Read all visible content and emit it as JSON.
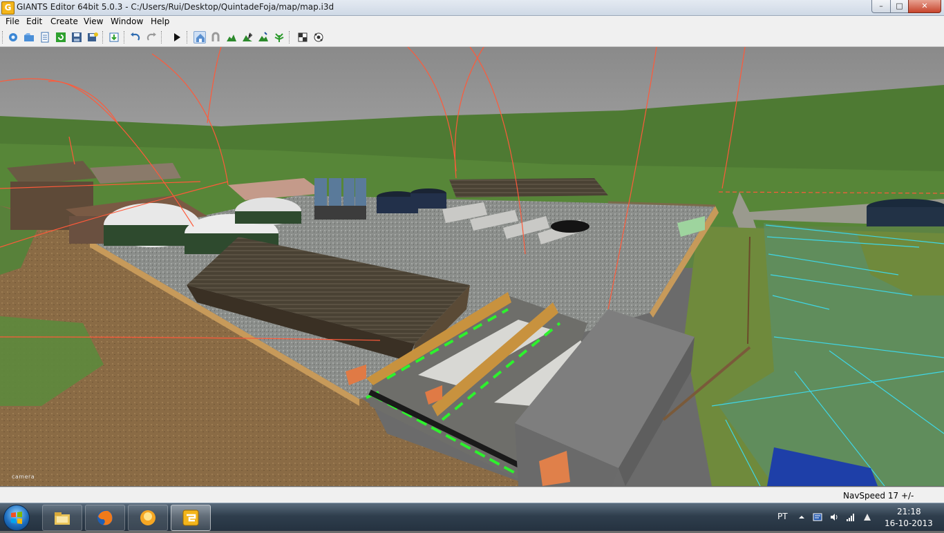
{
  "window": {
    "title": "GIANTS Editor 64bit 5.0.3 - C:/Users/Rui/Desktop/QuintadeFoja/map/map.i3d",
    "app_icon_letter": "G",
    "controls": {
      "minimize": "–",
      "maximize": "□",
      "close": "✕"
    }
  },
  "menu": {
    "items": [
      {
        "label": "File"
      },
      {
        "label": "Edit"
      },
      {
        "label": "Create"
      },
      {
        "label": "View"
      },
      {
        "label": "Window"
      },
      {
        "label": "Help"
      }
    ]
  },
  "toolbar": {
    "buttons": [
      "new-scene-icon",
      "open-icon",
      "properties-icon",
      "refresh-icon",
      "save-icon",
      "save-all-icon",
      "import-icon",
      "undo-icon",
      "redo-icon",
      "play-icon",
      "select-mode-icon",
      "move-mode-icon",
      "terrain-sculpt-icon",
      "terrain-paint-icon",
      "foliage-paint-icon",
      "plant-paint-icon",
      "material-icon",
      "particle-icon"
    ],
    "active_button": "select-mode-icon"
  },
  "viewport": {
    "camera_label": "camera",
    "colors": {
      "sky": "#8c8c8c",
      "grass": "#4c7a32",
      "gravel": "#8a8d8a",
      "dirt": "#8a6b45",
      "selection_green": "#2df22d",
      "water_lines": "#3fd7e6",
      "gizmo_lines": "#ff5a3a"
    }
  },
  "status": {
    "navspeed": "NavSpeed 17 +/-"
  },
  "taskbar": {
    "items": [
      "file-explorer-icon",
      "firefox-icon",
      "media-app-icon",
      "giants-editor-icon"
    ],
    "tray": {
      "language": "PT",
      "time": "21:18",
      "date": "16-10-2013"
    }
  }
}
